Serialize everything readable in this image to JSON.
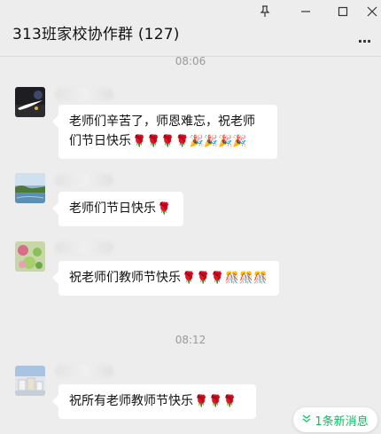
{
  "window": {
    "title": "313班家校协作群 (127)",
    "pin_icon": "pin-icon",
    "minimize_icon": "minimize-icon",
    "maximize_icon": "maximize-icon",
    "close_icon": "close-icon",
    "more_label": "..."
  },
  "messages": [
    {
      "time": "08:06",
      "text": "老师们辛苦了，师恩难忘，祝老师们节日快乐",
      "emojis": "🌹🌹🌹🌹🎉🎉🎉🎉"
    },
    {
      "text": "老师们节日快乐",
      "emojis": "🌹"
    },
    {
      "text": "祝老师们教师节快乐",
      "emojis": "🌹🌹🌹🎊🎊🎊"
    },
    {
      "time": "08:12",
      "text": "祝所有老师教师节快乐",
      "emojis": "🌹🌹🌹"
    }
  ],
  "new_messages": {
    "label": "1条新消息",
    "color": "#07c160"
  }
}
